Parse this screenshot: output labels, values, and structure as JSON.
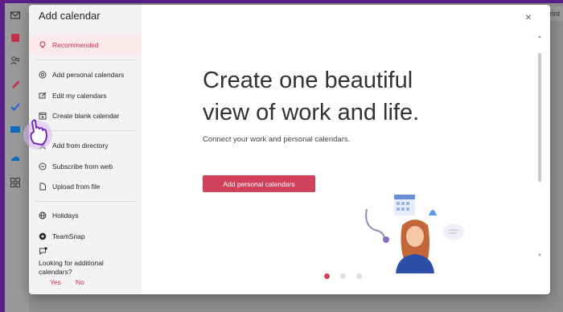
{
  "background_app": {
    "print_label": "Print",
    "rail_icons": [
      "mail-icon",
      "calendar-icon",
      "people-icon",
      "attach-icon",
      "todo-icon",
      "outlook-icon",
      "onedrive-icon",
      "apps-icon"
    ]
  },
  "modal": {
    "title": "Add calendar",
    "nav": [
      {
        "label": "Recommended",
        "icon": "lightbulb-icon",
        "active": true
      },
      {
        "label": "Add personal calendars",
        "icon": "at-icon"
      },
      {
        "label": "Edit my calendars",
        "icon": "edit-icon"
      },
      {
        "label": "Create blank calendar",
        "icon": "calendar-add-icon"
      },
      {
        "label": "Add from directory",
        "icon": "directory-icon"
      },
      {
        "label": "Subscribe from web",
        "icon": "link-icon"
      },
      {
        "label": "Upload from file",
        "icon": "file-icon"
      },
      {
        "label": "Holidays",
        "icon": "globe-icon"
      },
      {
        "label": "TeamSnap",
        "icon": "teamsnap-icon"
      }
    ],
    "more_prompt": "Looking for additional calendars?",
    "yes_label": "Yes",
    "no_label": "No",
    "close_label": "×"
  },
  "hero": {
    "headline_line1": "Create one beautiful",
    "headline_line2": "view of work and life.",
    "subtitle": "Connect your work and personal calendars.",
    "cta_label": "Add personal calendars",
    "carousel_active_index": 0,
    "carousel_count": 3
  },
  "colors": {
    "accent": "#d0425b",
    "active_bg": "#fbe9ec",
    "sidebar_bg": "#f3f3f3",
    "backdrop": "#5b1f8a"
  }
}
